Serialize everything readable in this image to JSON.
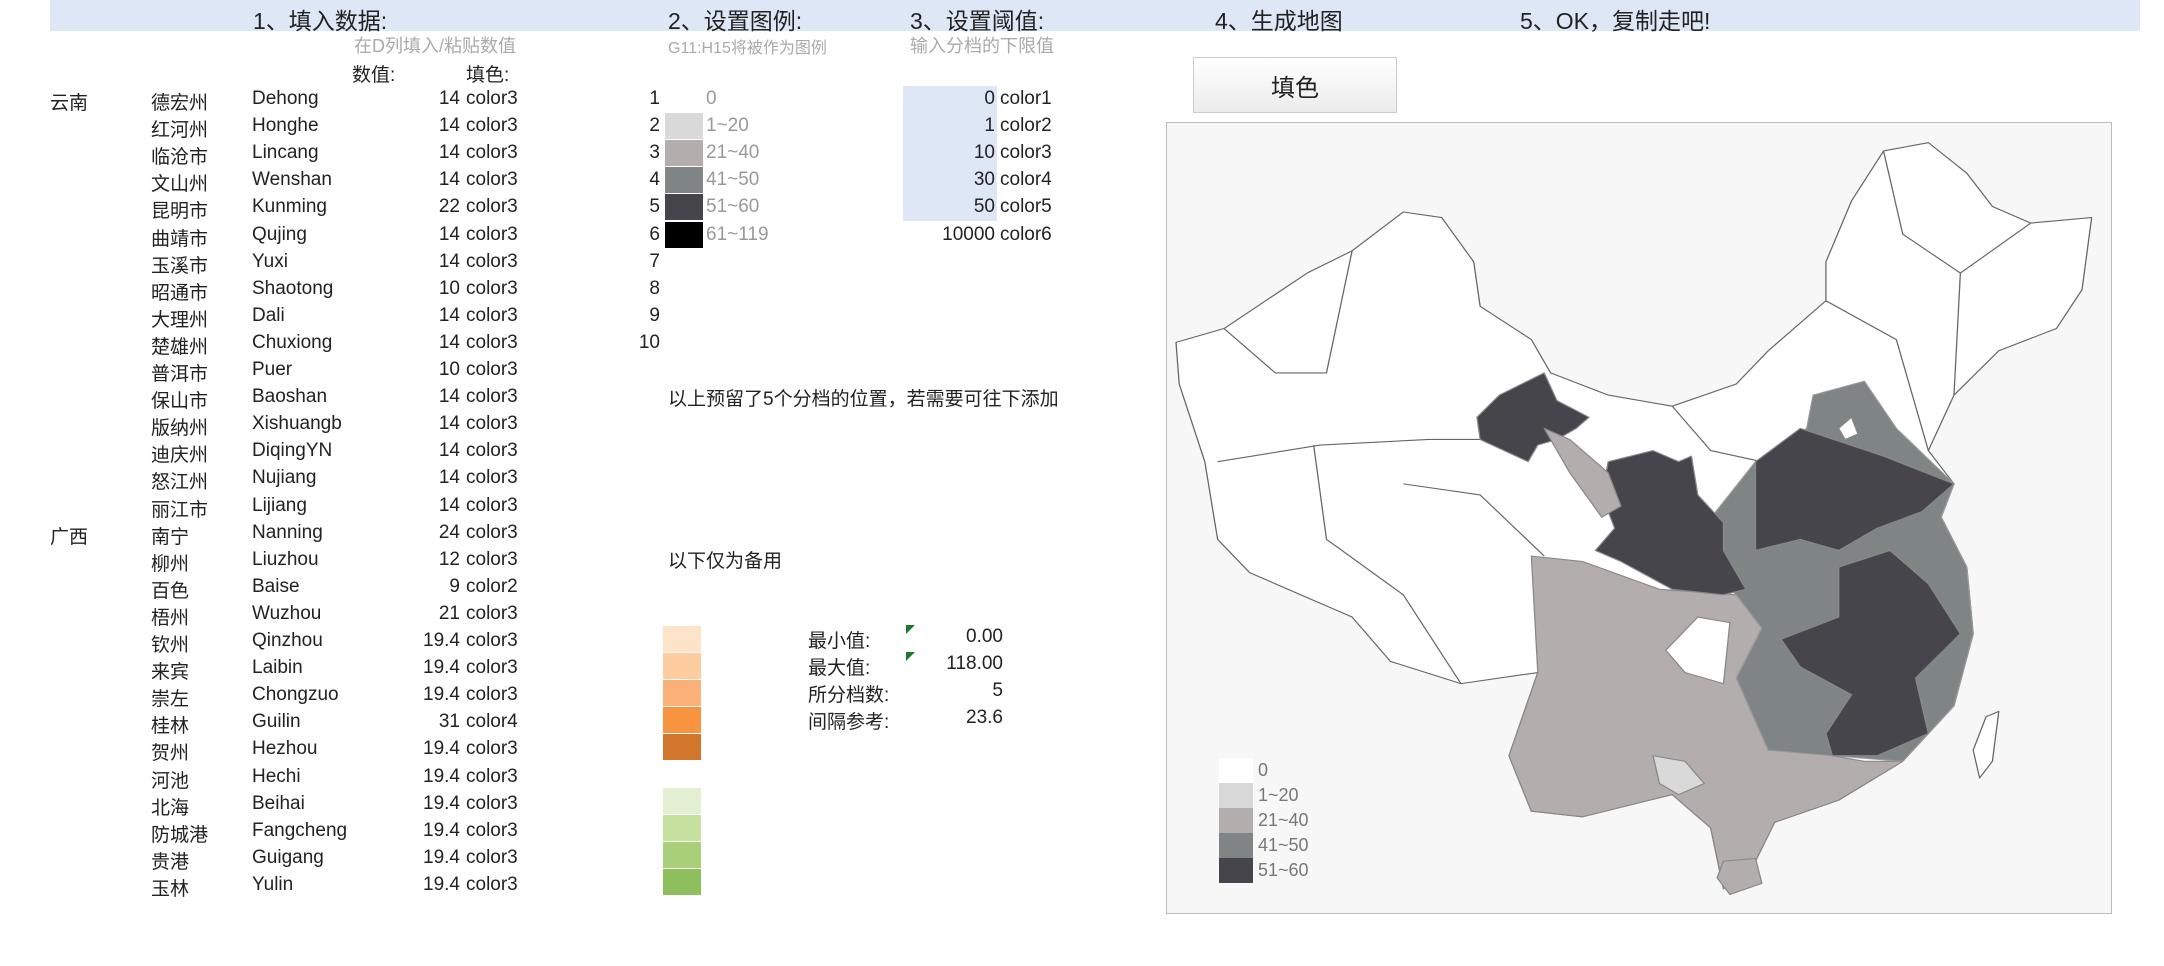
{
  "headers": [
    "1、填入数据:",
    "2、设置图例:",
    "3、设置阈值:",
    "4、生成地图",
    "5、OK，复制走吧!"
  ],
  "subheaders": [
    "在D列填入/粘贴数值",
    "G11:H15将被作为图例",
    "输入分档的下限值"
  ],
  "col_value": "数值:",
  "col_fill": "填色:",
  "rows": [
    {
      "prov": "云南",
      "cn": "德宏州",
      "en": "Dehong",
      "v": "14",
      "c": "color3"
    },
    {
      "prov": "",
      "cn": "红河州",
      "en": "Honghe",
      "v": "14",
      "c": "color3"
    },
    {
      "prov": "",
      "cn": "临沧市",
      "en": "Lincang",
      "v": "14",
      "c": "color3"
    },
    {
      "prov": "",
      "cn": "文山州",
      "en": "Wenshan",
      "v": "14",
      "c": "color3"
    },
    {
      "prov": "",
      "cn": "昆明市",
      "en": "Kunming",
      "v": "22",
      "c": "color3"
    },
    {
      "prov": "",
      "cn": "曲靖市",
      "en": "Qujing",
      "v": "14",
      "c": "color3"
    },
    {
      "prov": "",
      "cn": "玉溪市",
      "en": "Yuxi",
      "v": "14",
      "c": "color3"
    },
    {
      "prov": "",
      "cn": "昭通市",
      "en": "Shaotong",
      "v": "10",
      "c": "color3"
    },
    {
      "prov": "",
      "cn": "大理州",
      "en": "Dali",
      "v": "14",
      "c": "color3"
    },
    {
      "prov": "",
      "cn": "楚雄州",
      "en": "Chuxiong",
      "v": "14",
      "c": "color3"
    },
    {
      "prov": "",
      "cn": "普洱市",
      "en": "Puer",
      "v": "10",
      "c": "color3"
    },
    {
      "prov": "",
      "cn": "保山市",
      "en": "Baoshan",
      "v": "14",
      "c": "color3"
    },
    {
      "prov": "",
      "cn": "版纳州",
      "en": "Xishuangb",
      "v": "14",
      "c": "color3"
    },
    {
      "prov": "",
      "cn": "迪庆州",
      "en": "DiqingYN",
      "v": "14",
      "c": "color3"
    },
    {
      "prov": "",
      "cn": "怒江州",
      "en": "Nujiang",
      "v": "14",
      "c": "color3"
    },
    {
      "prov": "",
      "cn": "丽江市",
      "en": "Lijiang",
      "v": "14",
      "c": "color3"
    },
    {
      "prov": "广西",
      "cn": "南宁",
      "en": "Nanning",
      "v": "24",
      "c": "color3"
    },
    {
      "prov": "",
      "cn": "柳州",
      "en": "Liuzhou",
      "v": "12",
      "c": "color3"
    },
    {
      "prov": "",
      "cn": "百色",
      "en": "Baise",
      "v": "9",
      "c": "color2"
    },
    {
      "prov": "",
      "cn": "梧州",
      "en": "Wuzhou",
      "v": "21",
      "c": "color3"
    },
    {
      "prov": "",
      "cn": "钦州",
      "en": "Qinzhou",
      "v": "19.4",
      "c": "color3"
    },
    {
      "prov": "",
      "cn": "来宾",
      "en": "Laibin",
      "v": "19.4",
      "c": "color3"
    },
    {
      "prov": "",
      "cn": "崇左",
      "en": "Chongzuo",
      "v": "19.4",
      "c": "color3"
    },
    {
      "prov": "",
      "cn": "桂林",
      "en": "Guilin",
      "v": "31",
      "c": "color4"
    },
    {
      "prov": "",
      "cn": "贺州",
      "en": "Hezhou",
      "v": "19.4",
      "c": "color3"
    },
    {
      "prov": "",
      "cn": "河池",
      "en": "Hechi",
      "v": "19.4",
      "c": "color3"
    },
    {
      "prov": "",
      "cn": "北海",
      "en": "Beihai",
      "v": "19.4",
      "c": "color3"
    },
    {
      "prov": "",
      "cn": "防城港",
      "en": "Fangcheng",
      "v": "19.4",
      "c": "color3"
    },
    {
      "prov": "",
      "cn": "贵港",
      "en": "Guigang",
      "v": "19.4",
      "c": "color3"
    },
    {
      "prov": "",
      "cn": "玉林",
      "en": "Yulin",
      "v": "19.4",
      "c": "color3"
    }
  ],
  "legend": [
    {
      "n": "1",
      "label": "0",
      "color": "#ffffff"
    },
    {
      "n": "2",
      "label": "1~20",
      "color": "#d9d9d9"
    },
    {
      "n": "3",
      "label": "21~40",
      "color": "#b3adad"
    },
    {
      "n": "4",
      "label": "41~50",
      "color": "#7f8585"
    },
    {
      "n": "5",
      "label": "51~60",
      "color": "#46454b"
    },
    {
      "n": "6",
      "label": "61~119",
      "color": "#000000"
    },
    {
      "n": "7"
    },
    {
      "n": "8"
    },
    {
      "n": "9"
    },
    {
      "n": "10"
    }
  ],
  "thresholds": [
    {
      "v": "0",
      "c": "color1"
    },
    {
      "v": "1",
      "c": "color2"
    },
    {
      "v": "10",
      "c": "color3"
    },
    {
      "v": "30",
      "c": "color4"
    },
    {
      "v": "50",
      "c": "color5"
    },
    {
      "v": "10000",
      "c": "color6"
    }
  ],
  "note_reserved": "以上预留了5个分档的位置，若需要可往下添加",
  "note_backup": "以下仅为备用",
  "orange": [
    "#fde4c9",
    "#fdcc9f",
    "#fbb07a",
    "#f8933f",
    "#d2762c"
  ],
  "green": [
    "#e3efd2",
    "#c6e09e",
    "#a9d079",
    "#8dbf5c"
  ],
  "stats": [
    {
      "k": "最小值:",
      "v": "0.00"
    },
    {
      "k": "最大值:",
      "v": "118.00"
    },
    {
      "k": "所分档数:",
      "v": "5"
    },
    {
      "k": "间隔参考:",
      "v": "23.6"
    }
  ],
  "fill_button": "填色",
  "map_legend": [
    {
      "label": "0",
      "color": "#ffffff"
    },
    {
      "label": "1~20",
      "color": "#d9d9d9"
    },
    {
      "label": "21~40",
      "color": "#b3adad"
    },
    {
      "label": "41~50",
      "color": "#7f8585"
    },
    {
      "label": "51~60",
      "color": "#46454b"
    }
  ]
}
